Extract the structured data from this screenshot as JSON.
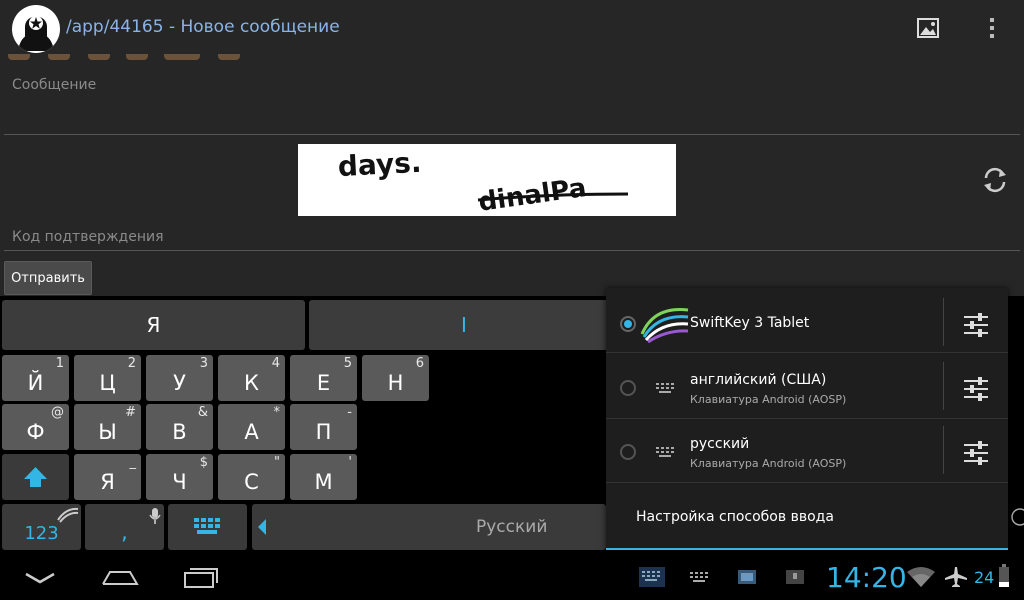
{
  "header": {
    "title": "/app/44165 - Новое сообщение"
  },
  "form": {
    "message_label": "Сообщение",
    "captcha_text_1": "days.",
    "captcha_text_2": "dinalPa",
    "code_label": "Код подтверждения",
    "send_label": "Отправить"
  },
  "keyboard": {
    "candidates": [
      "Я",
      "I"
    ],
    "rows": [
      [
        {
          "main": "Й",
          "sup": "1"
        },
        {
          "main": "Ц",
          "sup": "2"
        },
        {
          "main": "У",
          "sup": "3"
        },
        {
          "main": "К",
          "sup": "4"
        },
        {
          "main": "Е",
          "sup": "5"
        },
        {
          "main": "Н",
          "sup": "6"
        }
      ],
      [
        {
          "main": "Ф",
          "sup": "@"
        },
        {
          "main": "Ы",
          "sup": "#"
        },
        {
          "main": "В",
          "sup": "&"
        },
        {
          "main": "А",
          "sup": "*"
        },
        {
          "main": "П",
          "sup": "-"
        }
      ],
      [
        {
          "main": "Я",
          "sup": "_"
        },
        {
          "main": "Ч",
          "sup": "$"
        },
        {
          "main": "С",
          "sup": "\""
        },
        {
          "main": "М",
          "sup": "'"
        }
      ]
    ],
    "numbers_label": "123",
    "comma_label": ",",
    "space_label": "Русский"
  },
  "ime_popup": {
    "items": [
      {
        "name": "SwiftKey 3 Tablet",
        "sub": "",
        "selected": true
      },
      {
        "name": "английский (США)",
        "sub": "Клавиатура Android (AOSP)",
        "selected": false
      },
      {
        "name": "русский",
        "sub": "Клавиатура Android (AOSP)",
        "selected": false
      }
    ],
    "settings_label": "Настройка способов ввода"
  },
  "status": {
    "clock": "14:20",
    "battery": "24"
  },
  "colors": {
    "accent": "#33b5e5",
    "title": "#8ab4e8"
  }
}
